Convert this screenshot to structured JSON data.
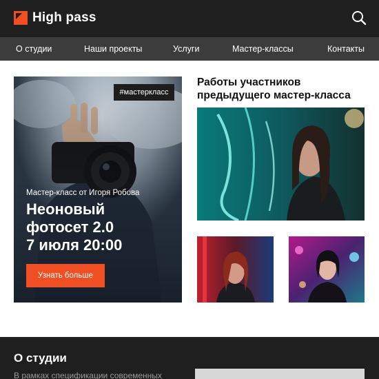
{
  "header": {
    "logo_text": "High pass",
    "logo_icon": "logo-mark-icon",
    "search_icon": "search-icon"
  },
  "nav": {
    "items": [
      "О студии",
      "Наши проекты",
      "Услуги",
      "Мастер-классы",
      "Контакты"
    ]
  },
  "hero": {
    "tag": "#мастеркласс",
    "subtitle": "Мастер-класс от Игоря Робова",
    "title_lines": [
      "Неоновый",
      "фотосет 2.0",
      "7 июля 20:00"
    ],
    "button": "Узнать больше"
  },
  "gallery": {
    "title_lines": [
      "Работы участников",
      "предыдущего мастер-класса"
    ]
  },
  "about": {
    "title": "О студии",
    "text": "В рамках спецификации современных"
  },
  "colors": {
    "accent": "#f04e23",
    "header_bg": "#1f1f1f",
    "nav_bg": "#3c3c3c"
  }
}
